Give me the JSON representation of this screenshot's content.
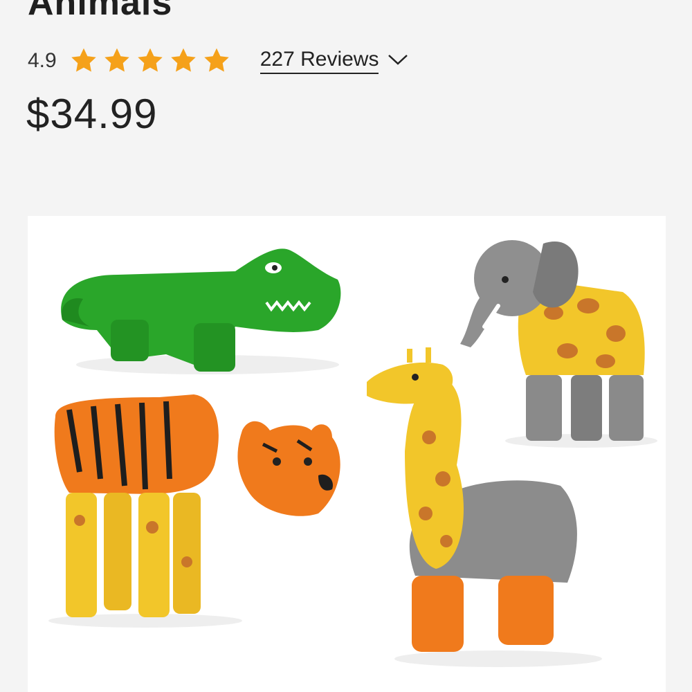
{
  "product": {
    "title": "Animals",
    "rating": "4.9",
    "star_count": 5,
    "reviews_label": "227 Reviews",
    "price": "$34.99",
    "image_description_icon": "toy-animals-image"
  },
  "colors": {
    "star": "#f5a11a",
    "text": "#222222",
    "background": "#f4f4f4"
  }
}
